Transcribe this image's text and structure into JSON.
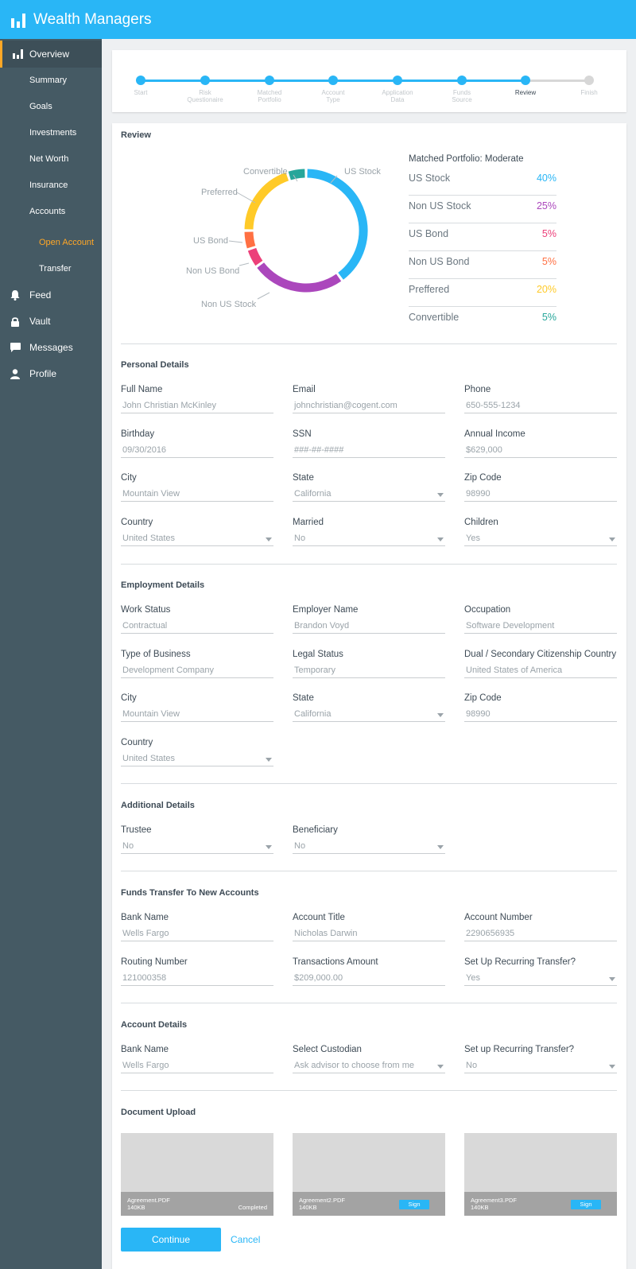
{
  "app": {
    "title": "Wealth Managers"
  },
  "sidebar": {
    "items": [
      {
        "label": "Overview",
        "icon": "bar-chart-icon"
      },
      {
        "label": "Summary"
      },
      {
        "label": "Goals"
      },
      {
        "label": "Investments"
      },
      {
        "label": "Net Worth"
      },
      {
        "label": "Insurance"
      },
      {
        "label": "Accounts"
      },
      {
        "label": "Open Account"
      },
      {
        "label": "Transfer"
      },
      {
        "label": "Feed",
        "icon": "bell-icon"
      },
      {
        "label": "Vault",
        "icon": "lock-icon"
      },
      {
        "label": "Messages",
        "icon": "chat-icon"
      },
      {
        "label": "Profile",
        "icon": "user-icon"
      }
    ]
  },
  "stepper": {
    "steps": [
      {
        "label": "Start",
        "state": "done"
      },
      {
        "label": "Risk\nQuestionaire",
        "state": "done"
      },
      {
        "label": "Matched\nPortfolio",
        "state": "done"
      },
      {
        "label": "Account\nType",
        "state": "done"
      },
      {
        "label": "Application\nData",
        "state": "done"
      },
      {
        "label": "Funds\nSource",
        "state": "done"
      },
      {
        "label": "Review",
        "state": "current"
      },
      {
        "label": "Finish",
        "state": "todo"
      }
    ]
  },
  "review": {
    "title": "Review",
    "portfolio_label": "Matched Portfolio: Moderate",
    "legend": [
      {
        "name": "US Stock",
        "value": "40%"
      },
      {
        "name": "Non US Stock",
        "value": "25%"
      },
      {
        "name": "US Bond",
        "value": "5%"
      },
      {
        "name": "Non US Bond",
        "value": "5%"
      },
      {
        "name": "Preffered",
        "value": "20%"
      },
      {
        "name": "Convertible",
        "value": "5%"
      }
    ]
  },
  "chart_data": {
    "type": "pie",
    "categories": [
      "US Stock",
      "Non US Stock",
      "Non US Bond",
      "US Bond",
      "Preferred",
      "Convertible"
    ],
    "values": [
      40,
      25,
      5,
      5,
      20,
      5
    ],
    "colors": [
      "#29b6f6",
      "#ab47bc",
      "#ec407a",
      "#ff7043",
      "#ffca28",
      "#26a69a"
    ]
  },
  "colors": {
    "accent": "#29b6f6",
    "sidebar": "#455a64",
    "active_marker": "#ffa726",
    "us_stock": "#29b6f6",
    "non_us_stock": "#ab47bc",
    "us_bond": "#ec407a",
    "non_us_bond": "#ff7043",
    "preffered": "#ffca28",
    "convertible": "#26a69a"
  },
  "personal": {
    "title": "Personal Details",
    "fields": [
      {
        "label": "Full Name",
        "value": "John Christian McKinley"
      },
      {
        "label": "Email",
        "value": "johnchristian@cogent.com"
      },
      {
        "label": "Phone",
        "value": "650-555-1234"
      },
      {
        "label": "Birthday",
        "value": "09/30/2016"
      },
      {
        "label": "SSN",
        "value": "###-##-####"
      },
      {
        "label": "Annual Income",
        "value": "$629,000"
      },
      {
        "label": "City",
        "value": "Mountain View"
      },
      {
        "label": "State",
        "value": "California",
        "dropdown": true
      },
      {
        "label": "Zip Code",
        "value": "98990"
      },
      {
        "label": "Country",
        "value": "United States",
        "dropdown": true
      },
      {
        "label": "Married",
        "value": "No",
        "dropdown": true
      },
      {
        "label": "Children",
        "value": "Yes",
        "dropdown": true
      }
    ]
  },
  "employment": {
    "title": "Employment Details",
    "fields": [
      {
        "label": "Work Status",
        "value": "Contractual"
      },
      {
        "label": "Employer Name",
        "value": "Brandon Voyd"
      },
      {
        "label": "Occupation",
        "value": "Software Development"
      },
      {
        "label": "Type of Business",
        "value": "Development Company"
      },
      {
        "label": "Legal Status",
        "value": "Temporary"
      },
      {
        "label": "Dual / Secondary Citizenship Country",
        "value": "United States of America"
      },
      {
        "label": "City",
        "value": "Mountain View"
      },
      {
        "label": "State",
        "value": "California",
        "dropdown": true
      },
      {
        "label": "Zip Code",
        "value": "98990"
      },
      {
        "label": "Country",
        "value": "United States",
        "dropdown": true
      }
    ]
  },
  "additional": {
    "title": "Additional Details",
    "fields": [
      {
        "label": "Trustee",
        "value": "No",
        "dropdown": true
      },
      {
        "label": "Beneficiary",
        "value": "No",
        "dropdown": true
      }
    ]
  },
  "funds": {
    "title": "Funds Transfer To New Accounts",
    "fields": [
      {
        "label": "Bank Name",
        "value": "Wells Fargo"
      },
      {
        "label": "Account Title",
        "value": "Nicholas Darwin"
      },
      {
        "label": "Account Number",
        "value": "2290656935"
      },
      {
        "label": "Routing Number",
        "value": "121000358"
      },
      {
        "label": "Transactions Amount",
        "value": "$209,000.00"
      },
      {
        "label": "Set Up Recurring Transfer?",
        "value": "Yes",
        "dropdown": true
      }
    ]
  },
  "account": {
    "title": "Account Details",
    "fields": [
      {
        "label": "Bank Name",
        "value": "Wells Fargo"
      },
      {
        "label": "Select Custodian",
        "value": "Ask advisor to choose from me",
        "dropdown": true
      },
      {
        "label": "Set up Recurring Transfer?",
        "value": "No",
        "dropdown": true
      }
    ]
  },
  "documents": {
    "title": "Document Upload",
    "items": [
      {
        "name": "Agreement.PDF",
        "size": "140KB",
        "status": "Completed"
      },
      {
        "name": "Agreement2.PDF",
        "size": "140KB",
        "action": "Sign"
      },
      {
        "name": "Agreement3.PDF",
        "size": "140KB",
        "action": "Sign"
      }
    ]
  },
  "actions": {
    "continue": "Continue",
    "cancel": "Cancel"
  }
}
